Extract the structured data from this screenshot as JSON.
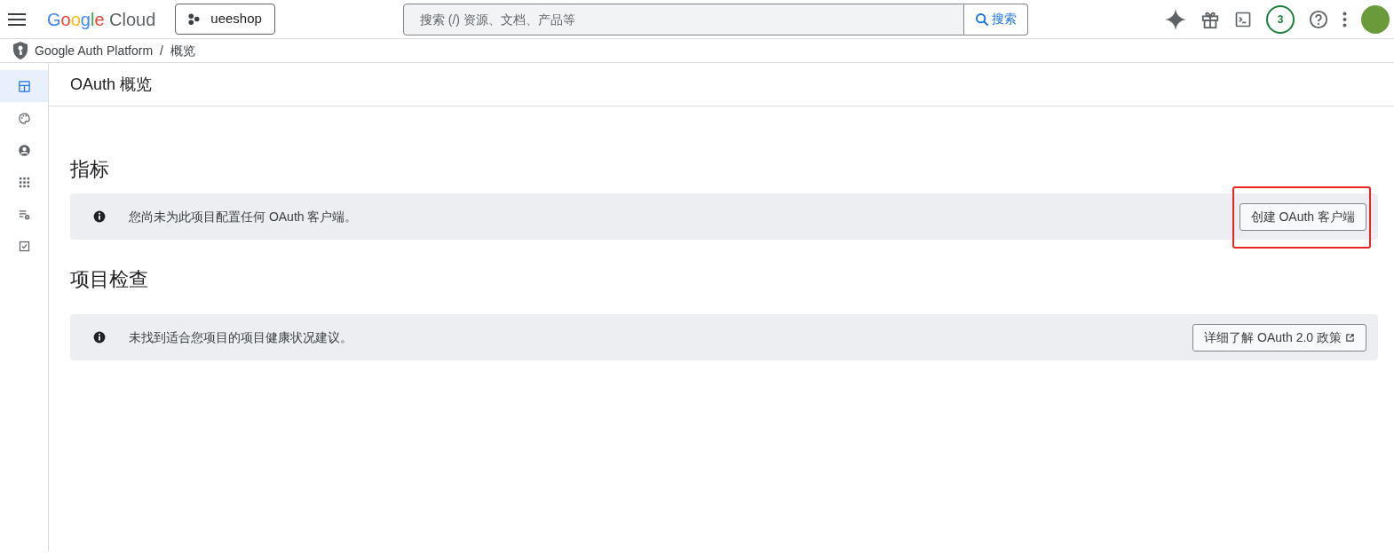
{
  "top_bar": {
    "logo_brand": "Google",
    "logo_product": "Cloud",
    "project": "ueeshop",
    "search": {
      "placeholder": "搜索 (/) 资源、文档、产品等",
      "button": "搜索"
    },
    "notifications_badge": "3"
  },
  "breadcrumb": [
    "Google Auth Platform",
    "/",
    "概览"
  ],
  "sidebar": {
    "items": [
      {
        "selected": true
      },
      {
        "selected": false
      },
      {
        "selected": false
      },
      {
        "selected": false
      },
      {
        "selected": false
      },
      {
        "selected": false
      }
    ]
  },
  "page_title": "OAuth 概览",
  "sections": [
    {
      "heading": "指标",
      "message": "您尚未为此项目配置任何 OAuth 客户端。",
      "button": "创建 OAuth 客户端",
      "external": false,
      "highlighted": true
    },
    {
      "heading": "项目检查",
      "message": "未找到适合您项目的项目健康状况建议。",
      "button": "详细了解 OAuth 2.0 政策",
      "external": true,
      "highlighted": false
    }
  ]
}
